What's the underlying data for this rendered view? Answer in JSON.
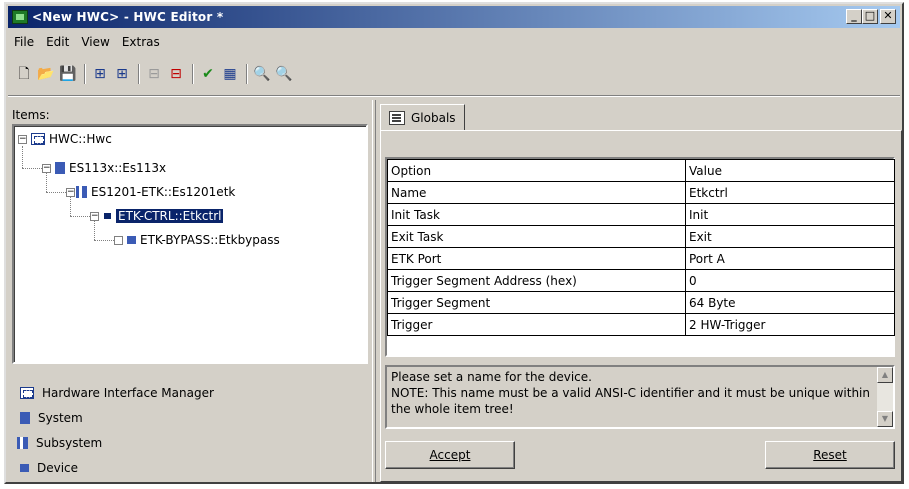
{
  "window": {
    "title": "<New HWC> - HWC Editor  *",
    "controls": [
      "_",
      "□",
      "✕"
    ]
  },
  "menu": [
    "File",
    "Edit",
    "View",
    "Extras"
  ],
  "toolbar_icons": [
    "new-icon",
    "open-icon",
    "save-icon",
    "add-system-icon",
    "add-subsystem-icon",
    "add-device-disabled-icon",
    "add-device-icon",
    "check-icon",
    "generate-icon",
    "search-icon",
    "search-next-icon"
  ],
  "left": {
    "items_label": "Items:",
    "tree": [
      {
        "label": "HWC::Hwc",
        "icon": "hwc-icon"
      },
      {
        "label": "ES113x::Es113x",
        "icon": "system-icon"
      },
      {
        "label": "ES1201-ETK::Es1201etk",
        "icon": "subsystem-icon"
      },
      {
        "label": "ETK-CTRL::Etkctrl",
        "icon": "device-icon"
      },
      {
        "label": "ETK-BYPASS::Etkbypass",
        "icon": "device-icon"
      }
    ],
    "legend": [
      {
        "label": "Hardware Interface Manager",
        "icon": "hwc-icon"
      },
      {
        "label": "System",
        "icon": "system-icon"
      },
      {
        "label": "Subsystem",
        "icon": "subsystem-icon"
      },
      {
        "label": "Device",
        "icon": "device-icon"
      }
    ]
  },
  "right": {
    "tab_label": "Globals",
    "columns": [
      "Option",
      "Value"
    ],
    "rows": [
      [
        "Name",
        "Etkctrl"
      ],
      [
        "Init Task",
        "Init"
      ],
      [
        "Exit Task",
        "Exit"
      ],
      [
        "ETK Port",
        "Port A"
      ],
      [
        "Trigger Segment Address (hex)",
        "0"
      ],
      [
        "Trigger Segment",
        "64 Byte"
      ],
      [
        "Trigger",
        "2 HW-Trigger"
      ]
    ],
    "description": "Please set a name for the device.\nNOTE: This name must be a valid ANSI-C identifier and it must be unique within the whole item tree!",
    "accept_label": "Accept",
    "reset_label": "Reset"
  }
}
